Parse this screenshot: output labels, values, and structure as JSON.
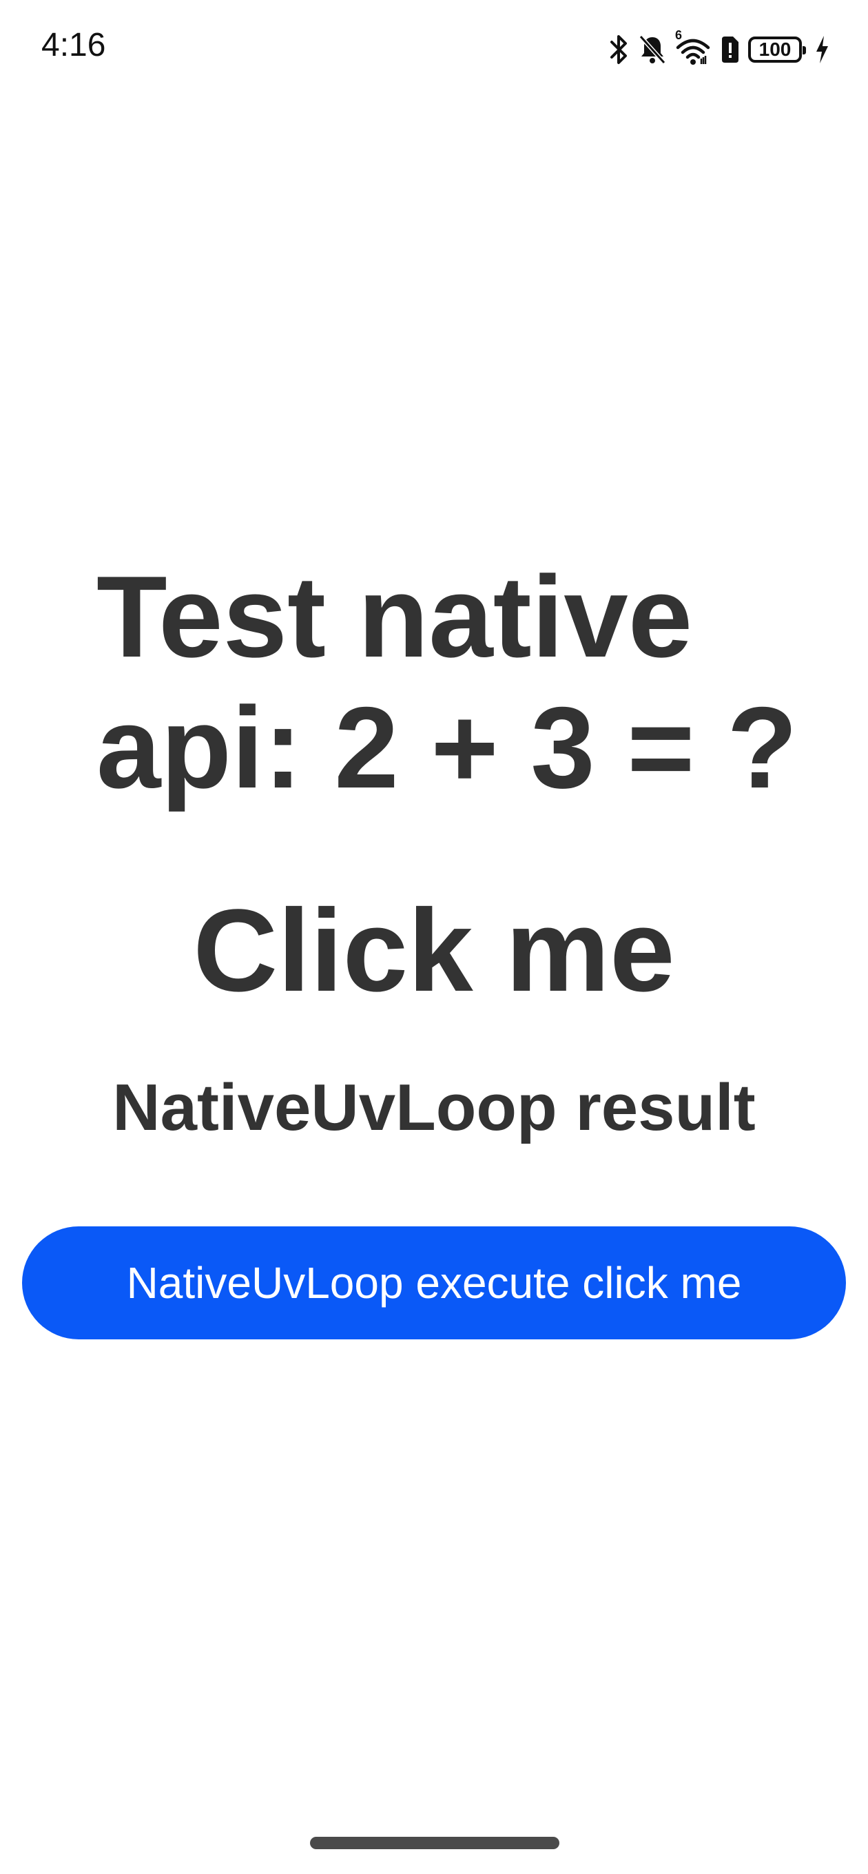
{
  "status_bar": {
    "time": "4:16",
    "battery_level": "100",
    "network_label": "6",
    "icons": [
      "bluetooth-icon",
      "bell-muted-icon",
      "wifi-icon",
      "sim-alert-icon",
      "battery-icon",
      "charging-icon"
    ]
  },
  "main": {
    "title": "Test native api: 2 + 3 = ?",
    "click_label": "Click me",
    "result_label": "NativeUvLoop result",
    "execute_button_label": "NativeUvLoop execute click me"
  },
  "colors": {
    "primary_button": "#0a59f7",
    "text": "#333333",
    "background": "#ffffff"
  }
}
